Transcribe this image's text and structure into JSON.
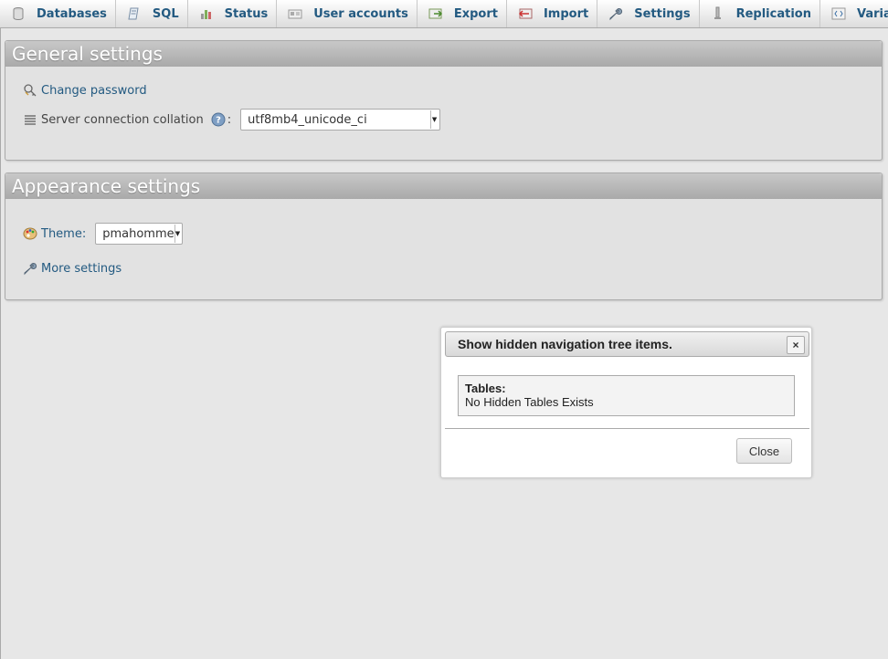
{
  "tabs": [
    {
      "label": "Databases",
      "icon": "database-icon"
    },
    {
      "label": "SQL",
      "icon": "sql-icon"
    },
    {
      "label": "Status",
      "icon": "status-icon"
    },
    {
      "label": "User accounts",
      "icon": "user-accounts-icon"
    },
    {
      "label": "Export",
      "icon": "export-icon"
    },
    {
      "label": "Import",
      "icon": "import-icon"
    },
    {
      "label": "Settings",
      "icon": "wrench-icon"
    },
    {
      "label": "Replication",
      "icon": "replication-icon"
    },
    {
      "label": "Variables",
      "icon": "variables-icon"
    }
  ],
  "general": {
    "title": "General settings",
    "change_password": "Change password",
    "collation_label": "Server connection collation",
    "collation_colon": ":",
    "collation_value": "utf8mb4_unicode_ci"
  },
  "appearance": {
    "title": "Appearance settings",
    "theme_label": "Theme:",
    "theme_value": "pmahomme",
    "more_settings": "More settings"
  },
  "dialog": {
    "title": "Show hidden navigation tree items.",
    "tables_heading": "Tables:",
    "tables_message": "No Hidden Tables Exists",
    "close_label": "Close",
    "close_x": "×"
  }
}
